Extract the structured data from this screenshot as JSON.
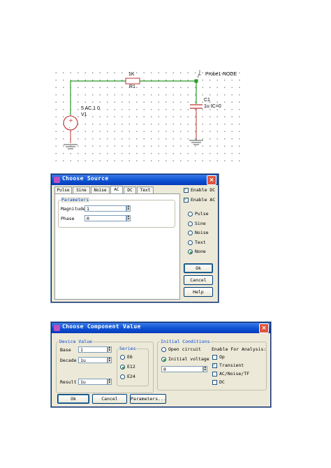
{
  "schematic": {
    "resistor_value": "1K",
    "resistor_name": "R1",
    "probe_label": "Probe1-NODE",
    "capacitor_name": "C1",
    "capacitor_value": "1u IC=0",
    "source_value": "5 AC 1 0",
    "source_name": "V1"
  },
  "choose_source": {
    "title": "Choose Source",
    "tabs": [
      "Pulse",
      "Sine",
      "Noise",
      "AC",
      "DC",
      "Text"
    ],
    "active_tab": "AC",
    "group_title": "Parameters",
    "magnitude_label": "Magnitude",
    "magnitude_value": "1",
    "phase_label": "Phase",
    "phase_value": "0",
    "enable_dc": "Enable DC",
    "enable_ac": "Enable AC",
    "radio_options": [
      "Pulse",
      "Sine",
      "Noise",
      "Text",
      "None"
    ],
    "selected_option": "None",
    "ok": "Ok",
    "cancel": "Cancel",
    "help": "Help"
  },
  "choose_component": {
    "title": "Choose Component Value",
    "device_value_title": "Device Value",
    "base_label": "Base",
    "base_value": "1",
    "decade_label": "Decade",
    "decade_value": "1u",
    "result_label": "Result",
    "result_value": "1u",
    "series_title": "Series",
    "series_options": [
      "E6",
      "E12",
      "E24"
    ],
    "series_selected": "E12",
    "initial_conditions_title": "Initial Conditions",
    "open_circuit": "Open circuit",
    "initial_voltage": "Initial voltage",
    "initial_voltage_value": "0",
    "enable_for_analysis": "Enable For Analysis:",
    "analysis_options": [
      "Op",
      "Transient",
      "AC/Noise/TF",
      "DC"
    ],
    "transient_checked": true,
    "ok": "Ok",
    "cancel": "Cancel",
    "parameters": "Parameters..."
  },
  "colors": {
    "wire": "#2a9a2a",
    "source": "#d03030",
    "title_bar": "#0a4fd1"
  }
}
